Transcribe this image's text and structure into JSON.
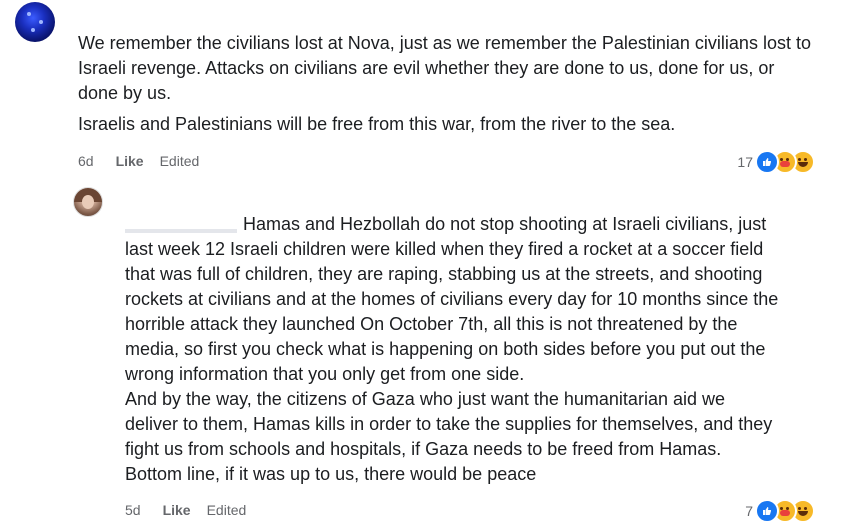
{
  "comments": [
    {
      "paragraphs": [
        "We remember the civilians lost at Nova, just as we remember the Palestinian civilians lost to Israeli revenge. Attacks on civilians are evil whether they are done to us, done for us, or done by us.",
        "Israelis and Palestinians will be free from this war, from the river to the sea."
      ],
      "time": "6d",
      "like_label": "Like",
      "edited_label": "Edited",
      "reaction_count": "17",
      "reactions": [
        "like-icon",
        "care-icon",
        "haha-icon"
      ]
    },
    {
      "text_lines": [
        "Hamas and Hezbollah do not stop shooting at Israeli civilians, just",
        "last week 12 Israeli children were killed when they fired a rocket at a soccer field",
        "that was full of children, they are raping, stabbing us at the streets, and shooting",
        "rockets at civilians and at the homes of civilians every day for 10 months since the",
        "horrible attack they launched On October 7th, all this is not threatened by the",
        "media, so first you check what is happening on both sides before you put out the",
        "wrong information that you only get from one side.",
        "And by the way, the citizens of Gaza who just want the humanitarian aid we",
        "deliver to them, Hamas kills in order to take the supplies for themselves, and they",
        "fight us from schools and hospitals, if Gaza needs to be freed from Hamas.",
        "Bottom line, if it was up to us, there would be peace"
      ],
      "time": "5d",
      "like_label": "Like",
      "edited_label": "Edited",
      "reaction_count": "7",
      "reactions": [
        "like-icon",
        "care-icon",
        "haha-icon"
      ]
    }
  ],
  "colors": {
    "like_blue": "#1877f2",
    "emoji_yellow": "#f7b928",
    "meta_gray": "#65676b",
    "text": "#1c1e21"
  }
}
